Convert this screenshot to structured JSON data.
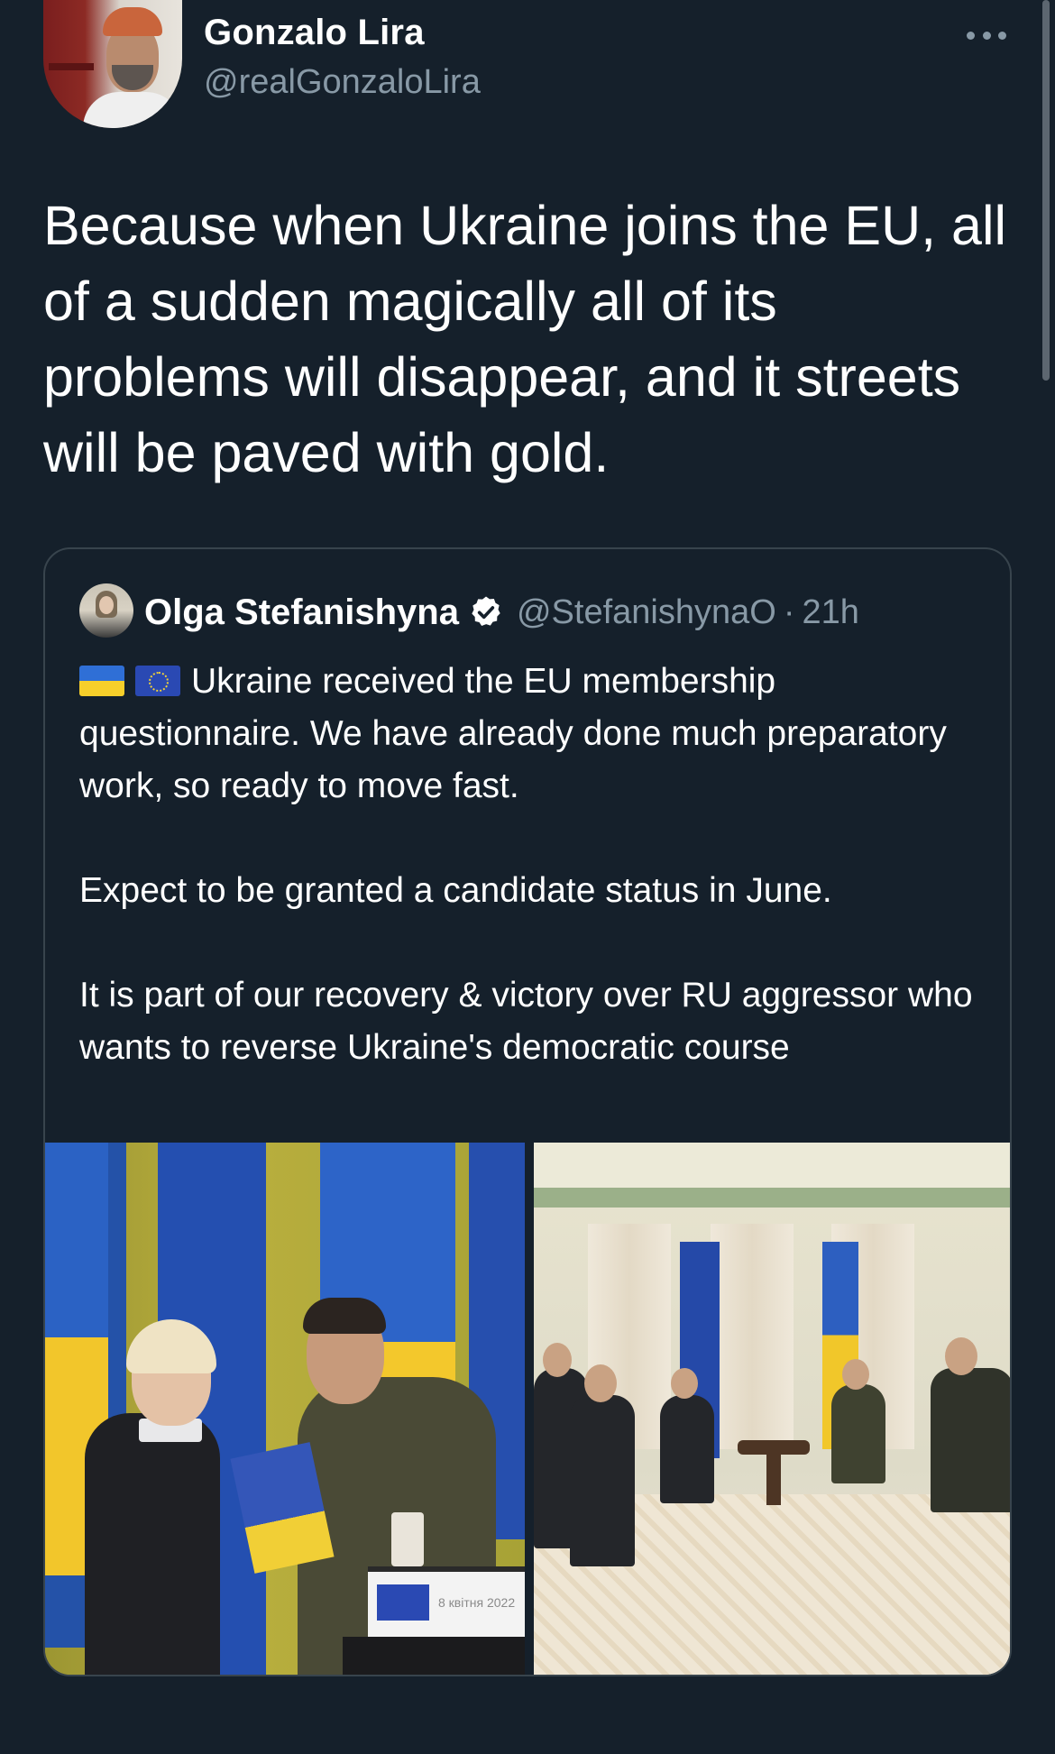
{
  "tweet": {
    "author_name": "Gonzalo Lira",
    "author_handle": "@realGonzaloLira",
    "text": "Because when Ukraine joins the EU, all of a sudden magically all of its problems will disappear, and it streets will be paved with gold.",
    "more_icon": "more-horizontal-icon"
  },
  "quote": {
    "author_name": "Olga Stefanishyna",
    "verified_icon": "verified-badge-icon",
    "author_handle": "@StefanishynaO",
    "separator": "·",
    "time": "21h",
    "flags": [
      "ukraine-flag-emoji",
      "eu-flag-emoji"
    ],
    "paragraph_1": "Ukraine received the EU membership questionnaire. We have already done much preparatory work, so ready to move fast.",
    "paragraph_2": "Expect to be granted a candidate status in June.",
    "paragraph_3": "It is part of our recovery & victory over RU aggressor who wants to reverse Ukraine's democratic course",
    "photo_left_sign_text": "8 квітня 2022"
  },
  "colors": {
    "background": "#15202b",
    "text_primary": "#ffffff",
    "text_secondary": "#8899a6",
    "border": "#38444d"
  }
}
